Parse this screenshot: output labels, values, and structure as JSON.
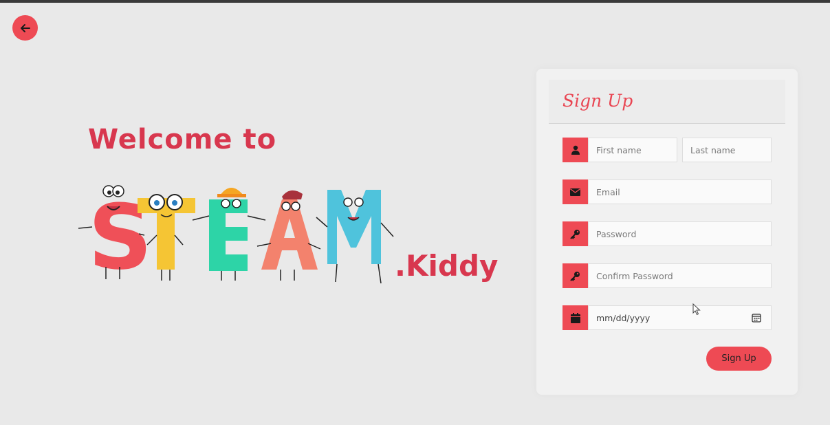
{
  "brand": {
    "welcome": "Welcome to",
    "steam": "STEAM",
    "kiddy": ".Kiddy"
  },
  "form": {
    "title": "Sign Up",
    "first_name_placeholder": "First name",
    "last_name_placeholder": "Last name",
    "email_placeholder": "Email",
    "password_placeholder": "Password",
    "confirm_password_placeholder": "Confirm Password",
    "date_placeholder": "mm/dd/yyyy",
    "submit_label": "Sign Up"
  },
  "icons": {
    "back": "arrow-left-icon",
    "first": "user-icon",
    "email": "envelope-icon",
    "password": "key-icon",
    "confirm": "key-icon",
    "date": "calendar-icon",
    "date_picker": "calendar-picker-icon"
  },
  "colors": {
    "accent": "#ee4a54",
    "brand_text": "#d8374e",
    "s": "#ef5058",
    "t": "#f5c534",
    "e": "#2dd4a7",
    "a": "#f3826d",
    "m": "#4fc3dc"
  }
}
